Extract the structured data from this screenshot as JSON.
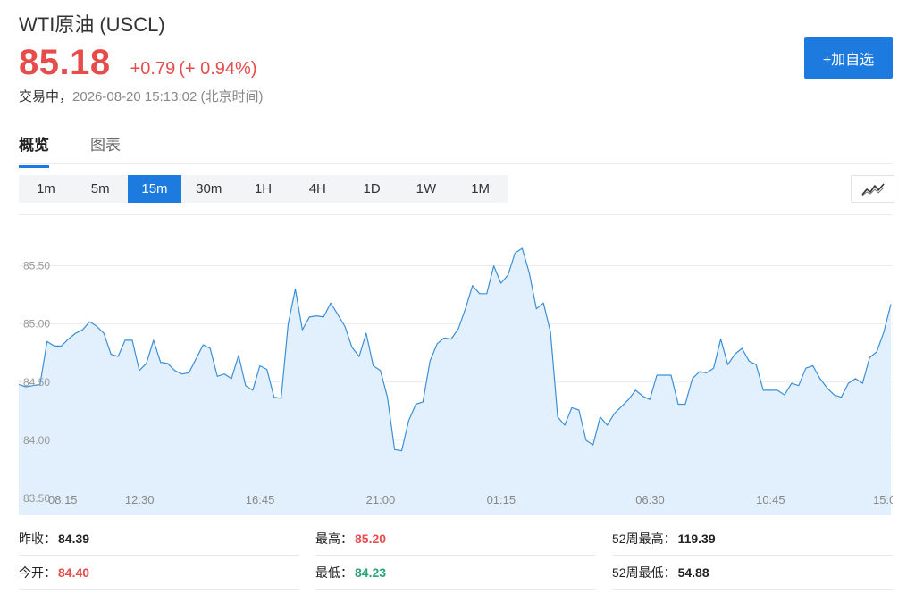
{
  "header": {
    "name": "WTI原油",
    "code": "(USCL)",
    "price": "85.18",
    "change": "+0.79",
    "change_pct": "(+ 0.94%)",
    "status": "交易中，",
    "timestamp": "2026-08-20 15:13:02 (北京时间)",
    "add_button": "+加自选"
  },
  "tabs": [
    {
      "label": "概览",
      "active": true
    },
    {
      "label": "图表",
      "active": false
    }
  ],
  "ranges": [
    {
      "label": "1m",
      "active": false
    },
    {
      "label": "5m",
      "active": false
    },
    {
      "label": "15m",
      "active": true
    },
    {
      "label": "30m",
      "active": false
    },
    {
      "label": "1H",
      "active": false
    },
    {
      "label": "4H",
      "active": false
    },
    {
      "label": "1D",
      "active": false
    },
    {
      "label": "1W",
      "active": false
    },
    {
      "label": "1M",
      "active": false
    }
  ],
  "chart_toggle_icon": "line-chart-icon",
  "colors": {
    "up": "#e74c4c",
    "down": "#27a374",
    "accent": "#1d7be0",
    "line": "#3c8fd6",
    "fill": "#e2f0fd"
  },
  "chart_data": {
    "type": "area",
    "y_ticks": [
      "85.50",
      "85.00",
      "84.50",
      "84.00",
      "83.50"
    ],
    "ylim": [
      83.5,
      85.75
    ],
    "x_ticks": [
      {
        "label": "08:15",
        "i": 0
      },
      {
        "label": "12:30",
        "i": 17
      },
      {
        "label": "16:45",
        "i": 34
      },
      {
        "label": "21:00",
        "i": 51
      },
      {
        "label": "01:15",
        "i": 68
      },
      {
        "label": "06:30",
        "i": 89
      },
      {
        "label": "10:45",
        "i": 106
      },
      {
        "label": "15:0",
        "i": 123
      }
    ],
    "values": [
      84.48,
      84.46,
      84.47,
      84.48,
      84.85,
      84.81,
      84.81,
      84.87,
      84.92,
      84.95,
      85.02,
      84.98,
      84.92,
      84.74,
      84.72,
      84.86,
      84.86,
      84.6,
      84.66,
      84.86,
      84.67,
      84.66,
      84.6,
      84.57,
      84.58,
      84.7,
      84.82,
      84.79,
      84.55,
      84.57,
      84.53,
      84.73,
      84.47,
      84.43,
      84.64,
      84.61,
      84.37,
      84.36,
      85.0,
      85.3,
      84.95,
      85.06,
      85.07,
      85.06,
      85.18,
      85.08,
      84.98,
      84.8,
      84.72,
      84.92,
      84.64,
      84.6,
      84.37,
      83.92,
      83.91,
      84.17,
      84.31,
      84.33,
      84.68,
      84.83,
      84.88,
      84.87,
      84.96,
      85.13,
      85.33,
      85.26,
      85.26,
      85.5,
      85.35,
      85.42,
      85.61,
      85.65,
      85.44,
      85.13,
      85.18,
      84.93,
      84.2,
      84.13,
      84.28,
      84.26,
      84.0,
      83.96,
      84.2,
      84.13,
      84.23,
      84.29,
      84.35,
      84.43,
      84.38,
      84.35,
      84.56,
      84.56,
      84.56,
      84.31,
      84.31,
      84.53,
      84.59,
      84.58,
      84.62,
      84.87,
      84.65,
      84.74,
      84.79,
      84.68,
      84.65,
      84.43,
      84.43,
      84.43,
      84.39,
      84.49,
      84.47,
      84.62,
      84.64,
      84.53,
      84.45,
      84.39,
      84.37,
      84.49,
      84.53,
      84.49,
      84.71,
      84.76,
      84.93,
      85.17
    ]
  },
  "stats": {
    "prev_close": {
      "label": "昨收：",
      "value": "84.39"
    },
    "high": {
      "label": "最高：",
      "value": "85.20"
    },
    "high_52w": {
      "label": "52周最高：",
      "value": "119.39"
    },
    "open": {
      "label": "今开：",
      "value": "84.40"
    },
    "low": {
      "label": "最低：",
      "value": "84.23"
    },
    "low_52w": {
      "label": "52周最低：",
      "value": "54.88"
    }
  }
}
